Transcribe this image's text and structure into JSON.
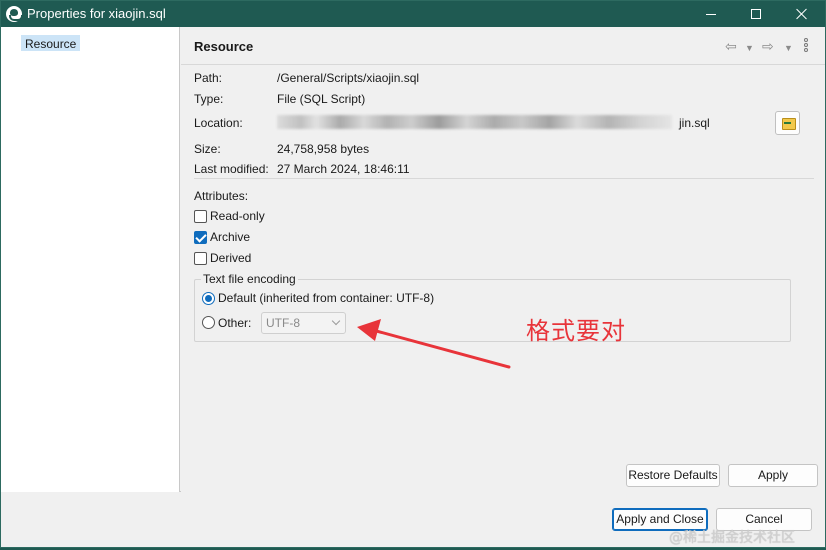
{
  "window": {
    "title": "Properties for xiaojin.sql",
    "icon": "eclipse-app-icon"
  },
  "tree": {
    "items": [
      {
        "label": "Resource",
        "selected": true
      }
    ]
  },
  "page": {
    "title": "Resource",
    "nav_icons": [
      "back-arrow-icon",
      "chevron-down-icon",
      "forward-arrow-icon",
      "chevron-down-icon",
      "more-vertical-icon"
    ]
  },
  "info": {
    "path_label": "Path:",
    "path_value": "/General/Scripts/xiaojin.sql",
    "type_label": "Type:",
    "type_value": "File  (SQL Script)",
    "location_label": "Location:",
    "location_value_visible": "jin.sql",
    "size_label": "Size:",
    "size_value": "24,758,958  bytes",
    "modified_label": "Last modified:",
    "modified_value": "27 March 2024, 18:46:11"
  },
  "attributes": {
    "label": "Attributes:",
    "items": [
      {
        "label": "Read-only",
        "checked": false
      },
      {
        "label": "Archive",
        "checked": true
      },
      {
        "label": "Derived",
        "checked": false
      }
    ]
  },
  "encoding": {
    "group_title": "Text file encoding",
    "default_label": "Default (inherited from container: UTF-8)",
    "default_selected": true,
    "other_label": "Other:",
    "other_value": "UTF-8"
  },
  "buttons": {
    "restore_defaults": "Restore Defaults",
    "apply": "Apply",
    "apply_and_close": "Apply and Close",
    "cancel": "Cancel"
  },
  "annotation": {
    "text": "格式要对",
    "color": "#e8343a"
  },
  "watermark": "@稀土掘金技术社区",
  "colors": {
    "titlebar": "#1f5a52",
    "accent": "#0f6cbd",
    "selection": "#cce4f7"
  }
}
